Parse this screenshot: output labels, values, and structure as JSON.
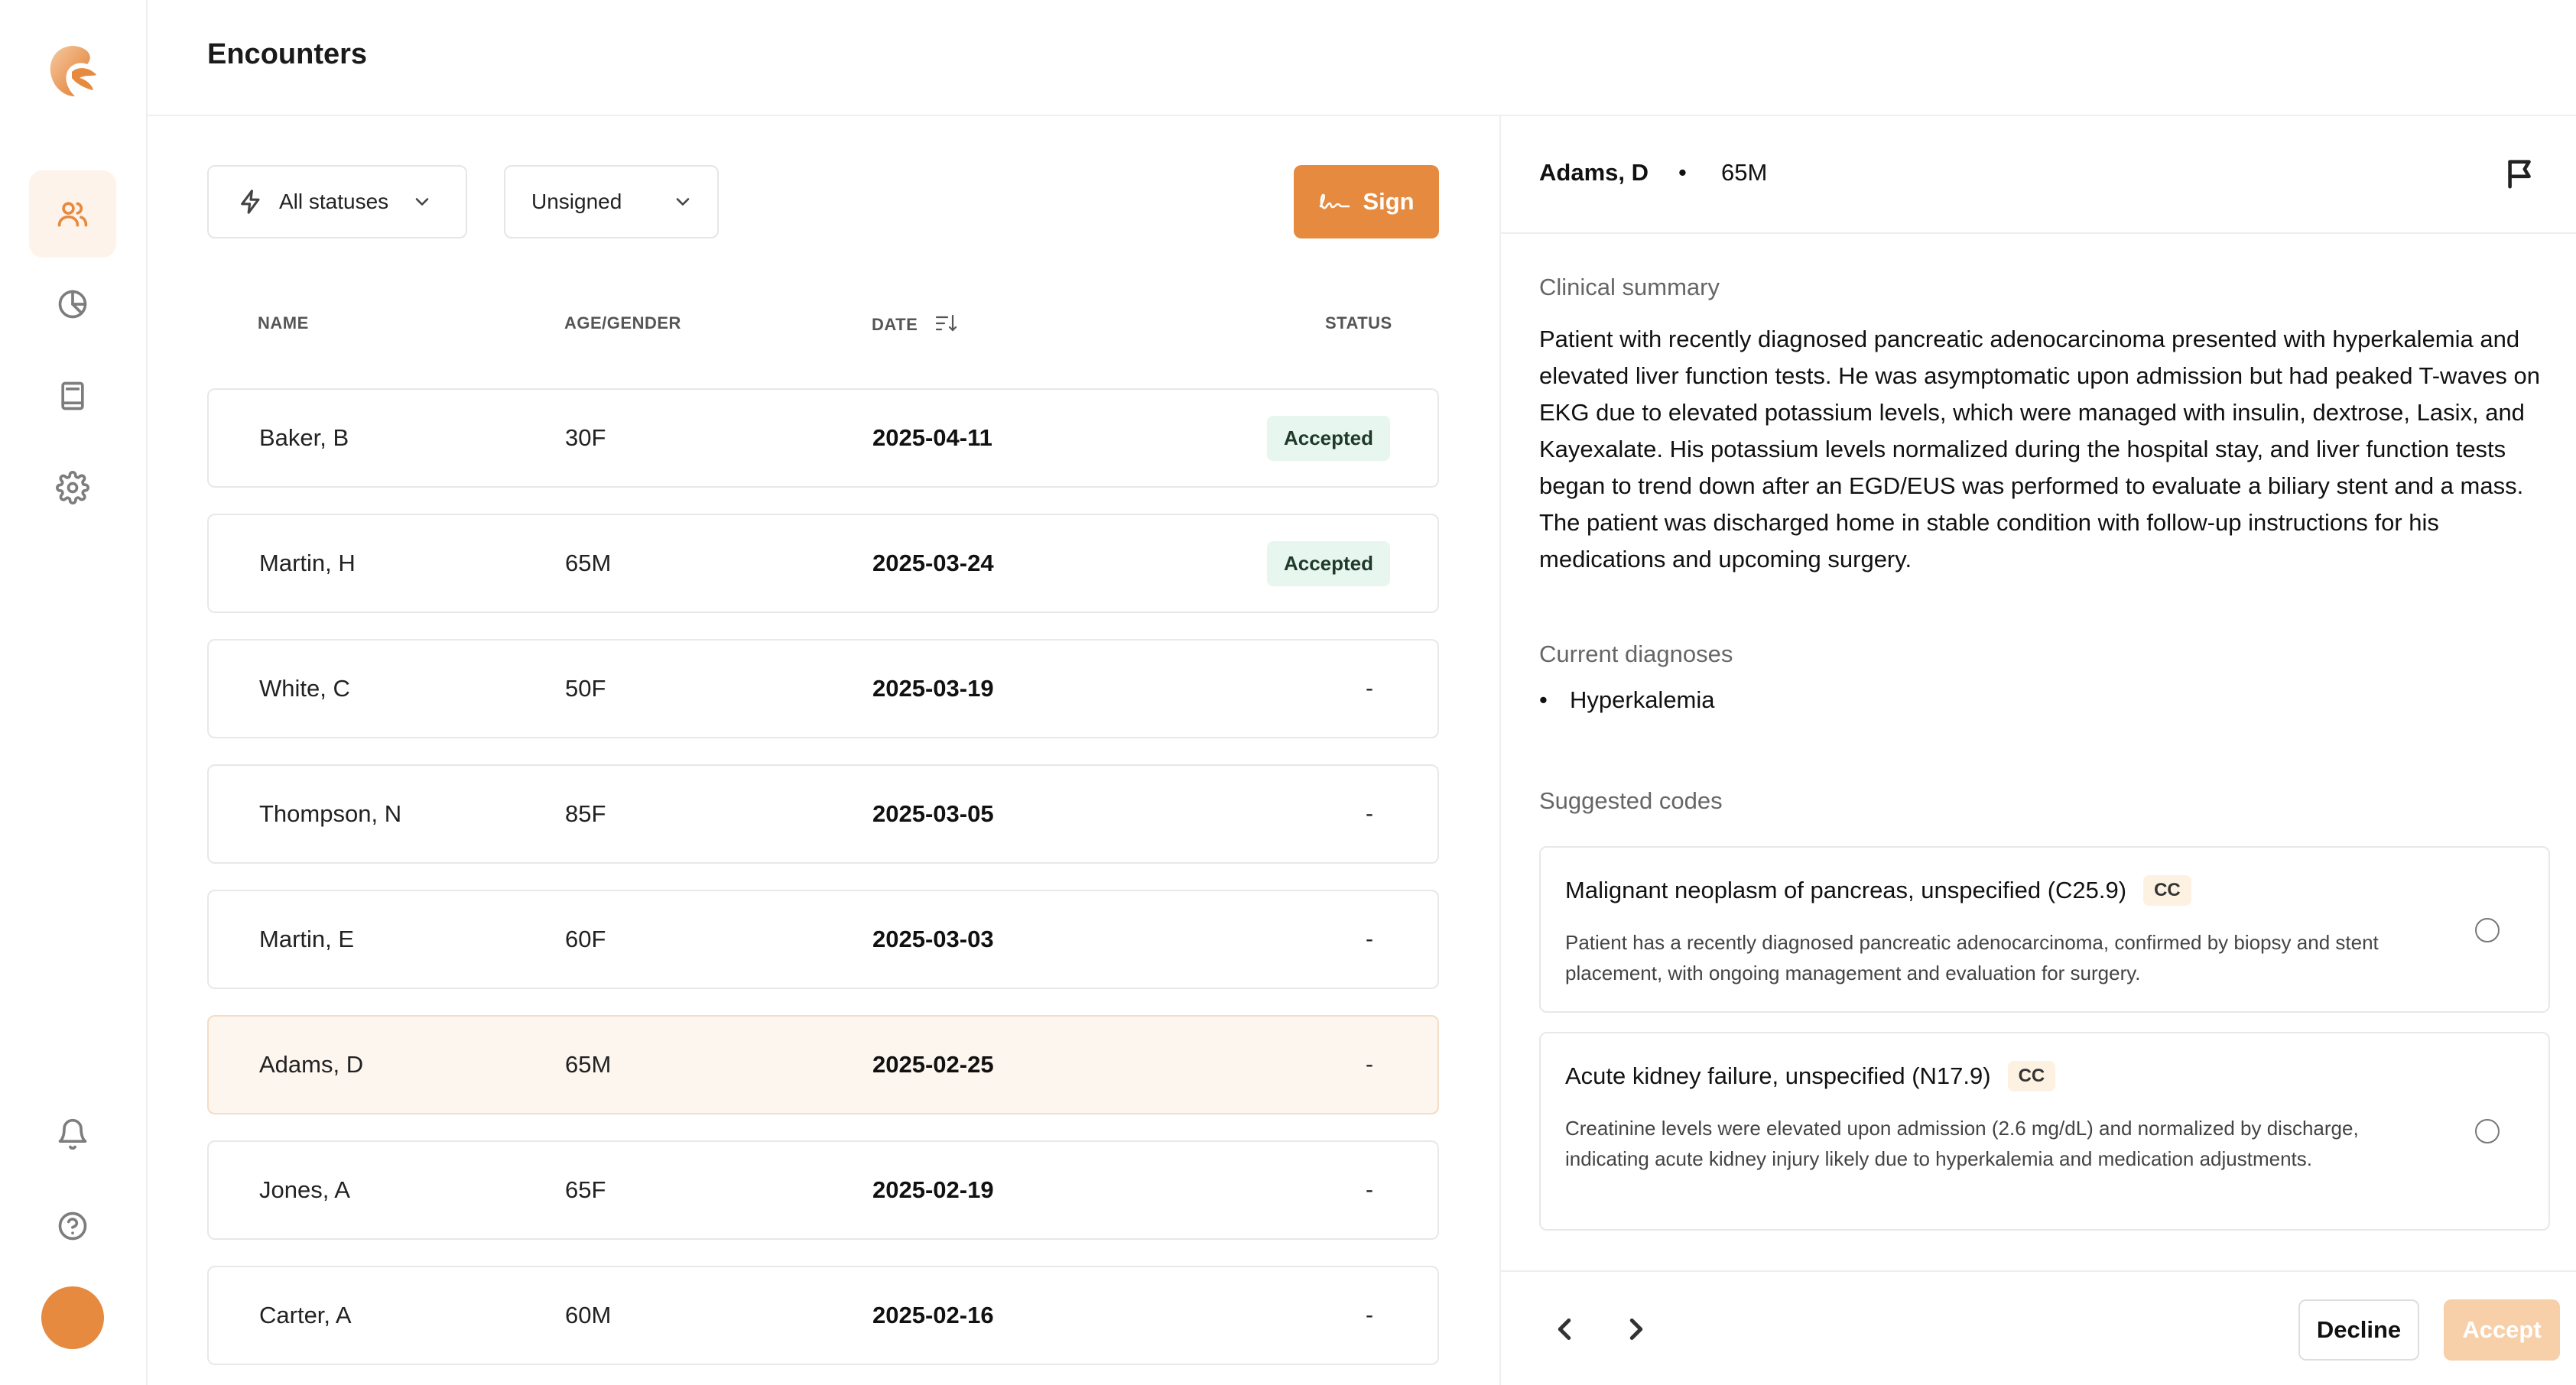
{
  "header": {
    "title": "Encounters"
  },
  "filters": {
    "status": "All statuses",
    "signed": "Unsigned",
    "sign_button": "Sign"
  },
  "table": {
    "columns": [
      "NAME",
      "AGE/GENDER",
      "DATE",
      "STATUS"
    ],
    "rows": [
      {
        "name": "Baker, B",
        "age": "30F",
        "date": "2025-04-11",
        "status": "Accepted"
      },
      {
        "name": "Martin, H",
        "age": "65M",
        "date": "2025-03-24",
        "status": "Accepted"
      },
      {
        "name": "White, C",
        "age": "50F",
        "date": "2025-03-19",
        "status": "-"
      },
      {
        "name": "Thompson, N",
        "age": "85F",
        "date": "2025-03-05",
        "status": "-"
      },
      {
        "name": "Martin, E",
        "age": "60F",
        "date": "2025-03-03",
        "status": "-"
      },
      {
        "name": "Adams, D",
        "age": "65M",
        "date": "2025-02-25",
        "status": "-"
      },
      {
        "name": "Jones, A",
        "age": "65F",
        "date": "2025-02-19",
        "status": "-"
      },
      {
        "name": "Carter, A",
        "age": "60M",
        "date": "2025-02-16",
        "status": "-"
      }
    ]
  },
  "detail": {
    "patient_name": "Adams, D",
    "separator": "•",
    "patient_age": "65M",
    "summary_label": "Clinical summary",
    "summary_text": "Patient with recently diagnosed pancreatic adenocarcinoma presented with hyperkalemia and elevated liver function tests. He was asymptomatic upon admission but had peaked T-waves on EKG due to elevated potassium levels, which were managed with insulin, dextrose, Lasix, and Kayexalate. His potassium levels normalized during the hospital stay, and liver function tests began to trend down after an EGD/EUS was performed to evaluate a biliary stent and a mass. The patient was discharged home in stable condition with follow-up instructions for his medications and upcoming surgery.",
    "diagnoses_label": "Current diagnoses",
    "diagnoses": [
      "Hyperkalemia"
    ],
    "codes_label": "Suggested codes",
    "codes": [
      {
        "title": "Malignant neoplasm of pancreas, unspecified (C25.9)",
        "tag": "CC",
        "description": "Patient has a recently diagnosed pancreatic adenocarcinoma, confirmed by biopsy and stent placement, with ongoing management and evaluation for surgery."
      },
      {
        "title": "Acute kidney failure, unspecified (N17.9)",
        "tag": "CC",
        "description": "Creatinine levels were elevated upon admission (2.6 mg/dL) and normalized by discharge, indicating acute kidney injury likely due to hyperkalemia and medication adjustments."
      }
    ],
    "decline_label": "Decline",
    "accept_label": "Accept"
  },
  "colors": {
    "accent": "#e58a3e",
    "accent_soft": "#fdf3ea",
    "accepted_bg": "#e7f6ee"
  }
}
